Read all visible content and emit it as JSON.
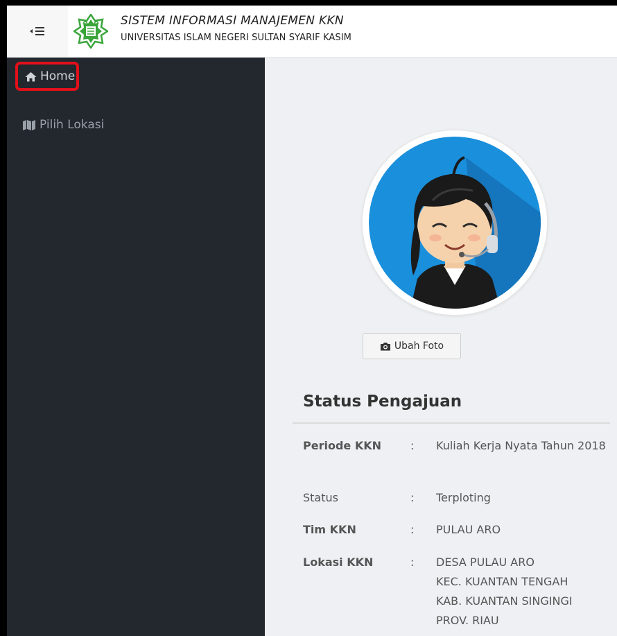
{
  "header": {
    "title": "SISTEM INFORMASI MANAJEMEN KKN",
    "subtitle": "UNIVERSITAS ISLAM NEGERI SULTAN SYARIF KASIM",
    "toggle_icon": "sidebar-toggle-icon",
    "logo_icon": "uin-suska-logo"
  },
  "sidebar": {
    "items": [
      {
        "label": "Home",
        "icon": "home-icon",
        "active": true
      },
      {
        "label": "Pilih Lokasi",
        "icon": "map-icon",
        "active": false
      }
    ]
  },
  "profile": {
    "avatar_icon": "user-avatar-operator",
    "change_photo_label": "Ubah Foto",
    "change_photo_icon": "camera-icon"
  },
  "status": {
    "title": "Status Pengajuan",
    "rows": [
      {
        "label": "Periode KKN",
        "colon": ":",
        "value": "Kuliah Kerja Nyata Tahun 2018"
      },
      {
        "label": "Status",
        "colon": ":",
        "value": "Terploting"
      },
      {
        "label": "Tim KKN",
        "colon": ":",
        "value": "PULAU ARO"
      },
      {
        "label": "Lokasi KKN",
        "colon": ":",
        "value_lines": [
          "DESA PULAU ARO",
          "KEC. KUANTAN TENGAH",
          "KAB. KUANTAN SINGINGI",
          "PROV. RIAU"
        ]
      }
    ]
  },
  "colors": {
    "sidebar_bg": "#23272e",
    "highlight_border": "#e2101a",
    "avatar_bg": "#1a8fdc",
    "logo_green": "#3aa53a"
  }
}
